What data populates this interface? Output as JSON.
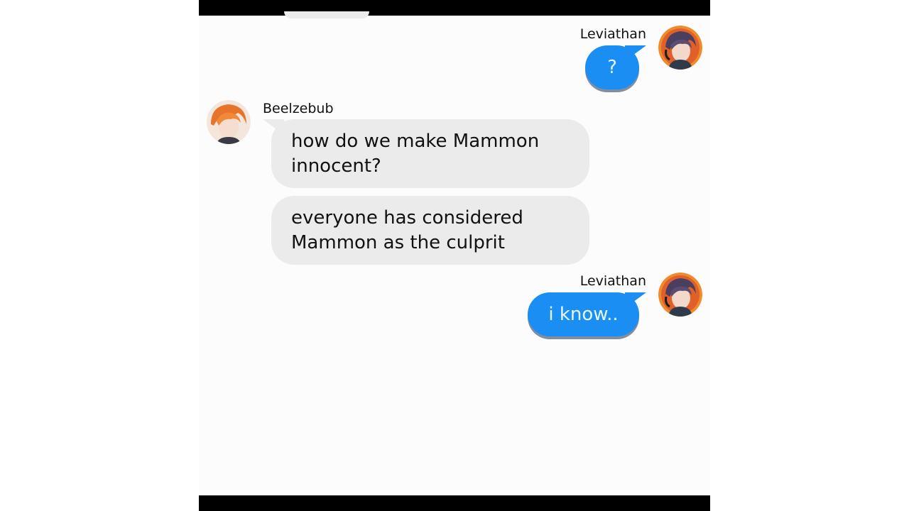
{
  "chat": {
    "messages": [
      {
        "sender": "Leviathan",
        "text": "?",
        "direction": "outgoing"
      },
      {
        "sender": "Beelzebub",
        "text": "how do we make Mammon innocent?",
        "line1": "how do we make Mammon",
        "line2": "innocent?",
        "direction": "incoming"
      },
      {
        "sender": "Beelzebub",
        "text": "everyone has considered Mammon as the culprit",
        "line1": "everyone has considered",
        "line2": "Mammon as the culprit",
        "direction": "incoming"
      },
      {
        "sender": "Leviathan",
        "text": "i know..",
        "direction": "outgoing"
      }
    ]
  },
  "colors": {
    "outgoing_bubble": "#1a8ef2",
    "incoming_bubble": "#ebebeb",
    "letterbox_bars": "#000000"
  },
  "icons": {
    "leviathan_avatar": "leviathan-avatar-icon",
    "beelzebub_avatar": "beelzebub-avatar-icon"
  }
}
